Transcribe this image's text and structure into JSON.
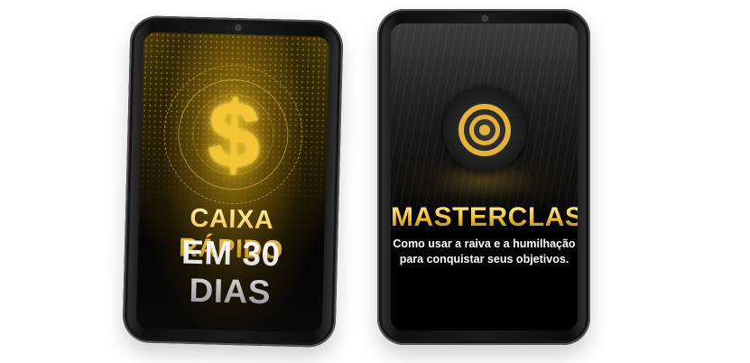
{
  "ebook1": {
    "title_line1": "CAIXA RÁPIDO",
    "title_line2": "EM 30 DIAS",
    "icon": "dollar-sign-icon"
  },
  "ebook2": {
    "title": "MASTERCLASS",
    "subtitle_line1": "Como usar a raiva e a humilhação",
    "subtitle_line2": "para conquistar seus objetivos.",
    "icon": "target-icon"
  },
  "colors": {
    "gold": "#f2c23c",
    "silver": "#dcdcdc",
    "background": "#ffffff",
    "bezel": "#111111"
  }
}
